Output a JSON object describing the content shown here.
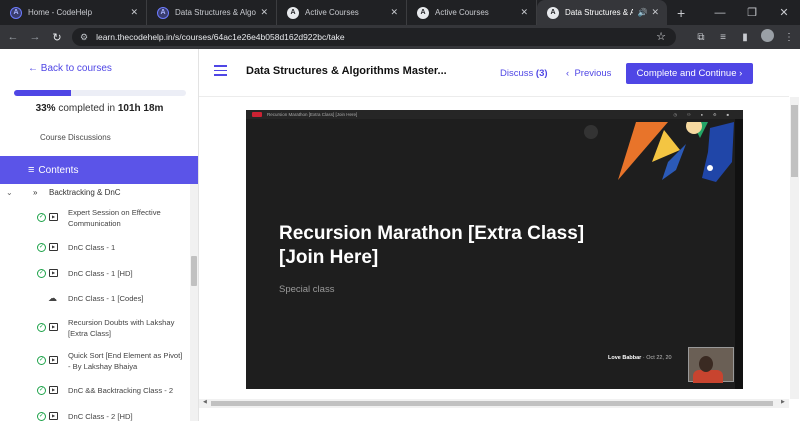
{
  "browser": {
    "tabs": [
      {
        "title": "Home - CodeHelp",
        "icon": "codehelp-icon",
        "active": false
      },
      {
        "title": "Data Structures & Algorithm",
        "icon": "codehelp-icon",
        "active": false
      },
      {
        "title": "Active Courses",
        "icon": "codehelp-icon",
        "active": false
      },
      {
        "title": "Active Courses",
        "icon": "codehelp-icon",
        "active": false
      },
      {
        "title": "Data Structures & Algori",
        "icon": "codehelp-icon",
        "active": true
      }
    ],
    "url": "learn.thecodehelp.in/s/courses/64ac1e26e4b058d162d922bc/take"
  },
  "sidebar": {
    "back_label": "Back to courses",
    "progress_percent": 33,
    "progress_pct_text": "33%",
    "progress_mid_text": "completed in",
    "progress_time": "101h 18m",
    "discussions_label": "Course Discussions",
    "contents_label": "Contents",
    "section_title": "Backtracking & DnC",
    "lessons": [
      {
        "title": "Expert Session on Effective Communication",
        "type": "video",
        "done": true
      },
      {
        "title": "DnC Class - 1",
        "type": "video",
        "done": true
      },
      {
        "title": "DnC Class - 1 [HD]",
        "type": "video",
        "done": true
      },
      {
        "title": "DnC Class - 1 [Codes]",
        "type": "download",
        "done": false
      },
      {
        "title": "Recursion Doubts with Lakshay [Extra Class]",
        "type": "video",
        "done": true
      },
      {
        "title": "Quick Sort [End Element as Pivot] - By Lakshay Bhaiya",
        "type": "video",
        "done": true
      },
      {
        "title": "DnC && Backtracking Class - 2",
        "type": "video",
        "done": true
      },
      {
        "title": "DnC Class - 2 [HD]",
        "type": "video",
        "done": true
      }
    ]
  },
  "main": {
    "course_title": "Data Structures & Algorithms Master...",
    "discuss_label": "Discuss",
    "discuss_count": "(3)",
    "previous_label": "Previous",
    "complete_label": "Complete and Continue"
  },
  "video": {
    "top_label": "Recursion Marathon [Extra Class] [Join Here]",
    "title": "Recursion Marathon [Extra Class] [Join Here]",
    "subtitle": "Special class",
    "instructor": "Love Babbar",
    "date": "Oct 22, 20"
  },
  "colors": {
    "accent": "#4f46e5",
    "success": "#1ea34a"
  }
}
